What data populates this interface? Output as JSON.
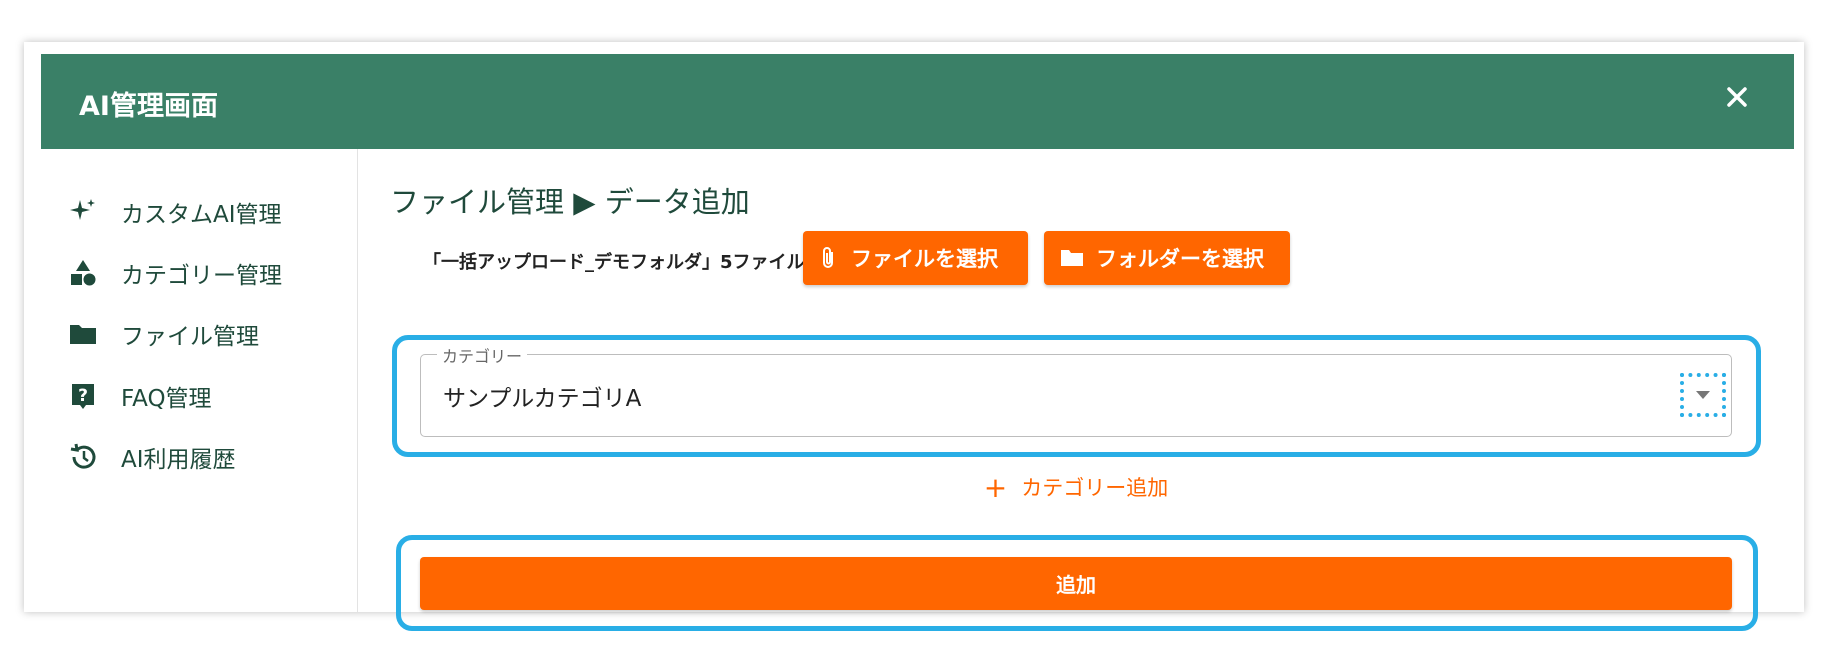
{
  "window": {
    "title": "AI管理画面"
  },
  "colors": {
    "header": "#3a8067",
    "accent": "#ff6600",
    "highlight": "#29aee6",
    "nav_text": "#1f4a3b"
  },
  "sidebar": {
    "items": [
      {
        "label": "カスタムAI管理",
        "icon": "sparkle-icon"
      },
      {
        "label": "カテゴリー管理",
        "icon": "shapes-icon"
      },
      {
        "label": "ファイル管理",
        "icon": "folder-icon"
      },
      {
        "label": "FAQ管理",
        "icon": "question-icon"
      },
      {
        "label": "AI利用履歴",
        "icon": "history-icon"
      }
    ]
  },
  "main": {
    "breadcrumb": "ファイル管理 ▶ データ追加",
    "file_summary": "「一括アップロード_デモフォルダ」5ファイル",
    "select_file_label": "ファイルを選択",
    "select_folder_label": "フォルダーを選択",
    "category": {
      "label": "カテゴリー",
      "value": "サンプルカテゴリA"
    },
    "add_category_label": "カテゴリー追加",
    "add_button_label": "追加"
  }
}
